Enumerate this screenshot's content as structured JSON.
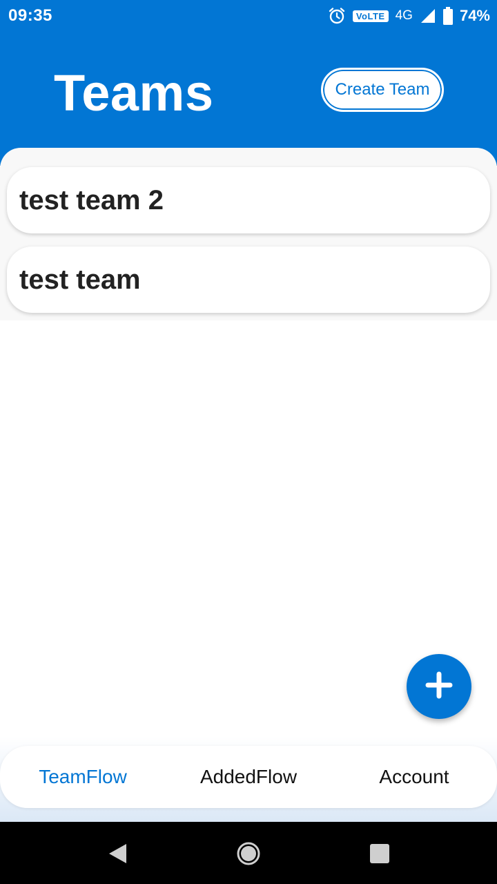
{
  "status_bar": {
    "time": "09:35",
    "volte": "VoLTE",
    "network": "4G",
    "battery": "74%"
  },
  "header": {
    "title": "Teams",
    "create_team_label": "Create Team"
  },
  "teams": [
    {
      "name": "test team 2"
    },
    {
      "name": "test team"
    }
  ],
  "bottom_nav": {
    "items": [
      {
        "label": "TeamFlow",
        "active": true
      },
      {
        "label": "AddedFlow",
        "active": false
      },
      {
        "label": "Account",
        "active": false
      }
    ]
  },
  "colors": {
    "primary": "#0276d4",
    "text_dark": "#222222",
    "background": "#ffffff"
  },
  "icons": {
    "status": [
      "alarm-icon",
      "signal-icon",
      "battery-icon"
    ],
    "fab": "plus-icon",
    "system_nav": [
      "back-icon",
      "home-icon",
      "recents-icon"
    ]
  }
}
